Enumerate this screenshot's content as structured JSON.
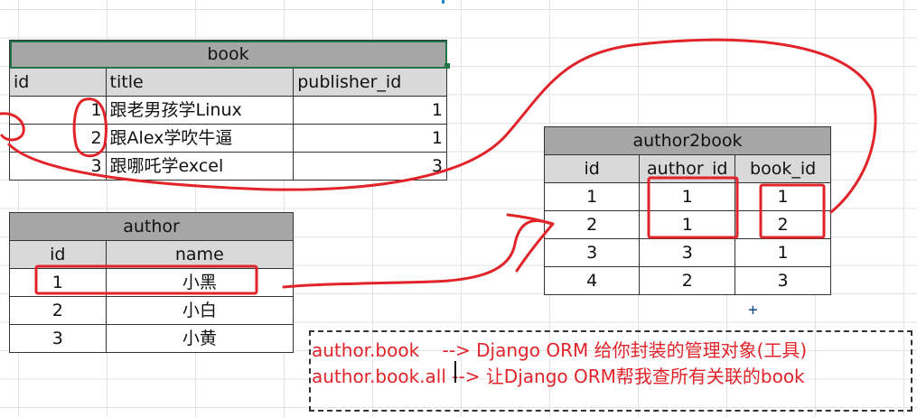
{
  "book": {
    "title": "book",
    "headers": [
      "id",
      "title",
      "publisher_id"
    ],
    "rows": [
      [
        "1",
        "跟老男孩学Linux",
        "1"
      ],
      [
        "2",
        "跟Alex学吹牛逼",
        "1"
      ],
      [
        "3",
        "跟哪吒学excel",
        "3"
      ]
    ]
  },
  "author": {
    "title": "author",
    "headers": [
      "id",
      "name"
    ],
    "rows": [
      [
        "1",
        "小黑"
      ],
      [
        "2",
        "小白"
      ],
      [
        "3",
        "小黄"
      ]
    ]
  },
  "author2book": {
    "title": "author2book",
    "headers": [
      "id",
      "author_id",
      "book_id"
    ],
    "rows": [
      [
        "1",
        "1",
        "1"
      ],
      [
        "2",
        "1",
        "2"
      ],
      [
        "3",
        "3",
        "1"
      ],
      [
        "4",
        "2",
        "3"
      ]
    ]
  },
  "notes": {
    "line1": "author.book    --> Django ORM 给你封装的管理对象(工具)",
    "line2": "author.book.all --> 让Django ORM帮我查所有关联的book"
  },
  "colors": {
    "annotation_red": "#e0242a",
    "header_dark": "#a6a6a6",
    "header_light": "#d9d9d9",
    "selection_green": "#217346"
  }
}
